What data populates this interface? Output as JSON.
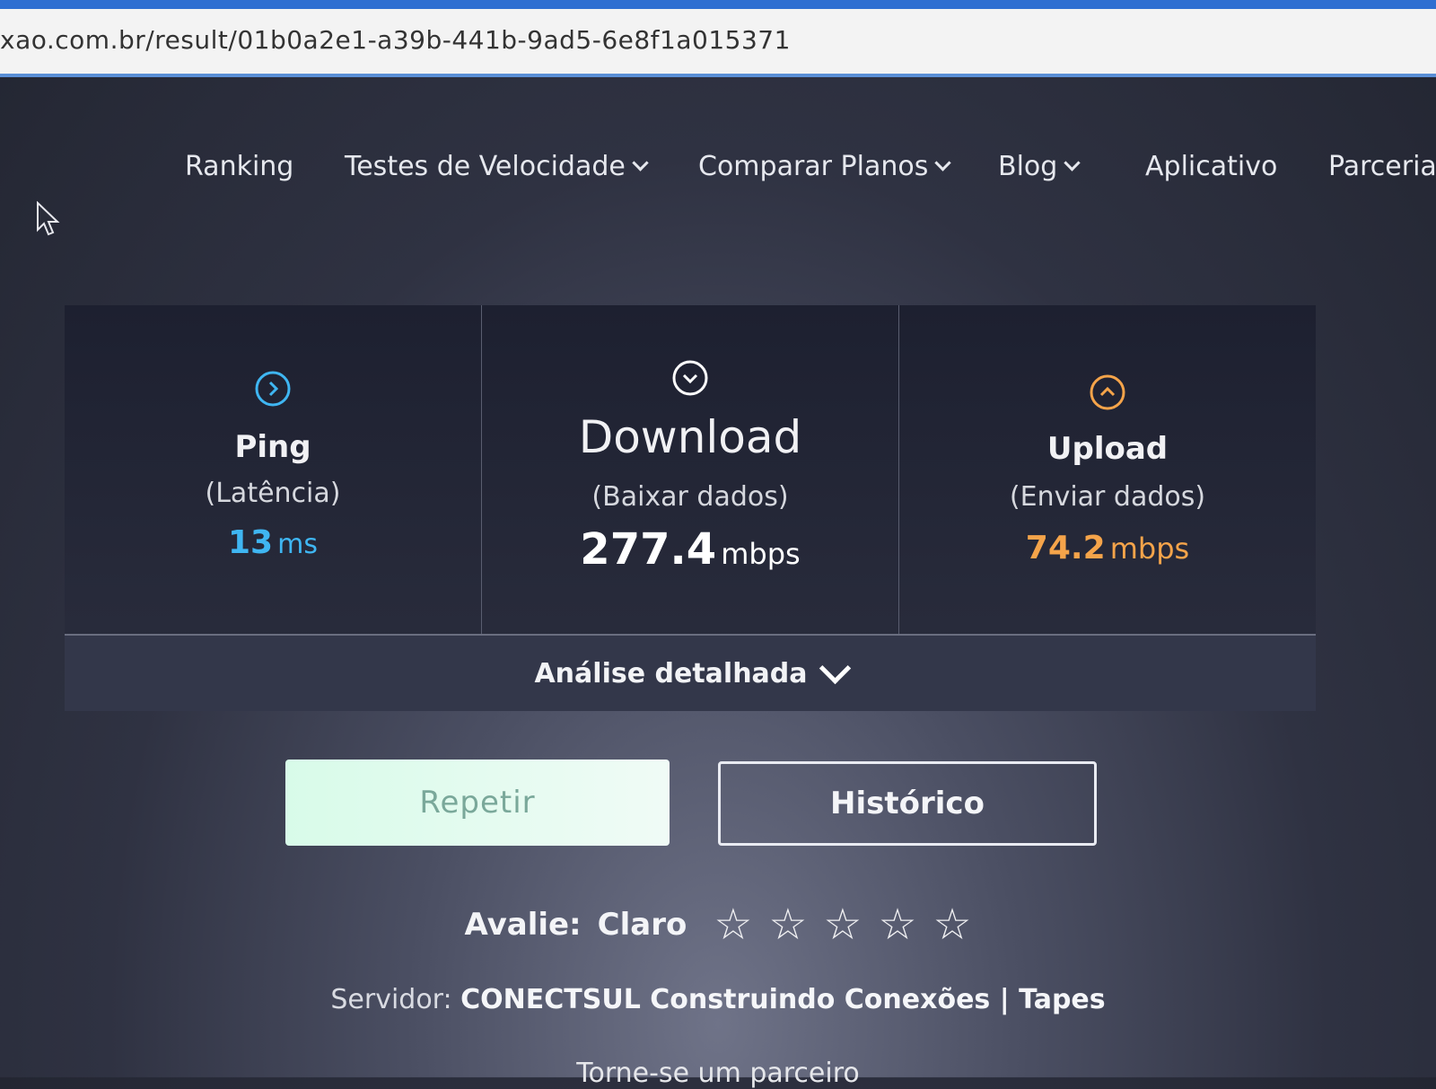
{
  "browser": {
    "url": "xao.com.br/result/01b0a2e1-a39b-441b-9ad5-6e8f1a015371"
  },
  "nav": {
    "items": [
      {
        "label": "Ranking",
        "dropdown": false
      },
      {
        "label": "Testes de Velocidade",
        "dropdown": true
      },
      {
        "label": "Comparar Planos",
        "dropdown": true
      },
      {
        "label": "Blog",
        "dropdown": true
      },
      {
        "label": "Aplicativo",
        "dropdown": false
      },
      {
        "label": "Parcerias",
        "dropdown": false
      }
    ]
  },
  "results": {
    "ping": {
      "title": "Ping",
      "subtitle": "(Latência)",
      "value": "13",
      "unit": "ms",
      "color": "#3fb6f2",
      "icon": "chevron-right-circle-icon"
    },
    "download": {
      "title": "Download",
      "subtitle": "(Baixar dados)",
      "value": "277.4",
      "unit": "mbps",
      "color": "#ffffff",
      "icon": "chevron-down-circle-icon"
    },
    "upload": {
      "title": "Upload",
      "subtitle": "(Enviar dados)",
      "value": "74.2",
      "unit": "mbps",
      "color": "#f5a44a",
      "icon": "chevron-up-circle-icon"
    }
  },
  "analysis": {
    "label": "Análise detalhada"
  },
  "buttons": {
    "repeat": "Repetir",
    "history": "Histórico"
  },
  "rating": {
    "label": "Avalie:",
    "provider": "Claro",
    "stars_total": 5,
    "stars_filled": 0
  },
  "server": {
    "label": "Servidor:",
    "name": "CONECTSUL Construindo Conexões | Tapes"
  },
  "footer_partial": "Torne-se um parceiro"
}
